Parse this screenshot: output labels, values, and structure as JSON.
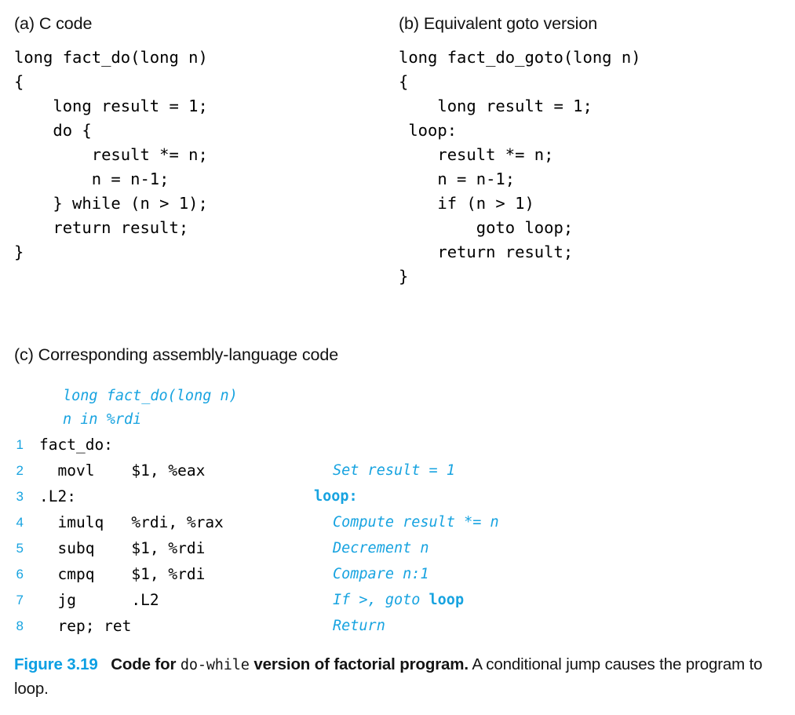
{
  "panels": {
    "a": {
      "heading": "(a) C code",
      "code": [
        "long fact_do(long n)",
        "{",
        "    long result = 1;",
        "    do {",
        "        result *= n;",
        "        n = n-1;",
        "    } while (n > 1);",
        "    return result;",
        "}"
      ]
    },
    "b": {
      "heading": "(b) Equivalent goto version",
      "code": [
        "long fact_do_goto(long n)",
        "{",
        "    long result = 1;",
        " loop:",
        "    result *= n;",
        "    n = n-1;",
        "    if (n > 1)",
        "        goto loop;",
        "    return result;",
        "}"
      ]
    },
    "c": {
      "heading": "(c) Corresponding assembly-language code",
      "header_lines": [
        "long fact_do(long n)",
        "n in %rdi"
      ],
      "rows": [
        {
          "num": "1",
          "code": "fact_do:",
          "comment": "",
          "comment_tail": "",
          "comment_is_label": false
        },
        {
          "num": "2",
          "code": "  movl    $1, %eax",
          "comment": "Set result = 1",
          "comment_tail": "",
          "comment_is_label": false
        },
        {
          "num": "3",
          "code": ".L2:",
          "comment": "loop:",
          "comment_tail": "",
          "comment_is_label": true
        },
        {
          "num": "4",
          "code": "  imulq   %rdi, %rax",
          "comment": "Compute result *= n",
          "comment_tail": "",
          "comment_is_label": false
        },
        {
          "num": "5",
          "code": "  subq    $1, %rdi",
          "comment": "Decrement n",
          "comment_tail": "",
          "comment_is_label": false
        },
        {
          "num": "6",
          "code": "  cmpq    $1, %rdi",
          "comment": "Compare n:1",
          "comment_tail": "",
          "comment_is_label": false
        },
        {
          "num": "7",
          "code": "  jg      .L2",
          "comment": "If >, goto ",
          "comment_tail": "loop",
          "comment_is_label": false
        },
        {
          "num": "8",
          "code": "  rep; ret",
          "comment": "Return",
          "comment_tail": "",
          "comment_is_label": false
        }
      ]
    }
  },
  "caption": {
    "label": "Figure 3.19",
    "bold_part_1": "Code for",
    "mono_part": "do-while",
    "bold_part_2": "version of factorial program.",
    "rest": "A conditional jump causes the program to loop."
  },
  "colors": {
    "accent_blue": "#0c9fe3",
    "comment_blue": "#17a3e0",
    "text_black": "#000000",
    "background": "#ffffff"
  }
}
